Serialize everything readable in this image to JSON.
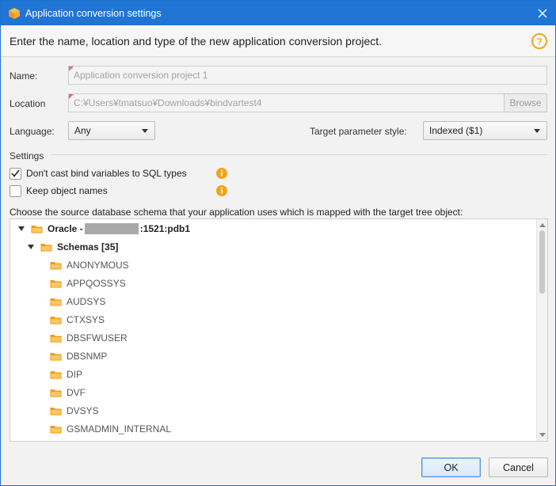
{
  "window": {
    "title": "Application conversion settings"
  },
  "header": {
    "text": "Enter the name, location and type of the new application conversion project."
  },
  "form": {
    "name_label": "Name:",
    "name_placeholder": "Application conversion project 1",
    "location_label": "Location",
    "location_value": "C:¥Users¥tmatsuo¥Downloads¥bindvartest4",
    "browse_label": "Browse",
    "language_label": "Language:",
    "language_value": "Any",
    "target_style_label": "Target parameter style:",
    "target_style_value": "Indexed ($1)"
  },
  "settings": {
    "section_label": "Settings",
    "options": [
      {
        "label": "Don't cast bind variables to SQL types",
        "checked": true
      },
      {
        "label": "Keep object names",
        "checked": false
      }
    ]
  },
  "schema": {
    "prompt": "Choose the source database schema that your application uses which is mapped with the target tree object:",
    "root": {
      "prefix": "Oracle -",
      "suffix": ":1521:pdb1"
    },
    "schemas_label": "Schemas [35]",
    "items": [
      "ANONYMOUS",
      "APPQOSSYS",
      "AUDSYS",
      "CTXSYS",
      "DBSFWUSER",
      "DBSNMP",
      "DIP",
      "DVF",
      "DVSYS",
      "GSMADMIN_INTERNAL"
    ]
  },
  "footer": {
    "ok_label": "OK",
    "cancel_label": "Cancel"
  },
  "colors": {
    "title_bar": "#1f74d4",
    "info_orange": "#f0a41c",
    "folder_orange": "#f39c12"
  }
}
